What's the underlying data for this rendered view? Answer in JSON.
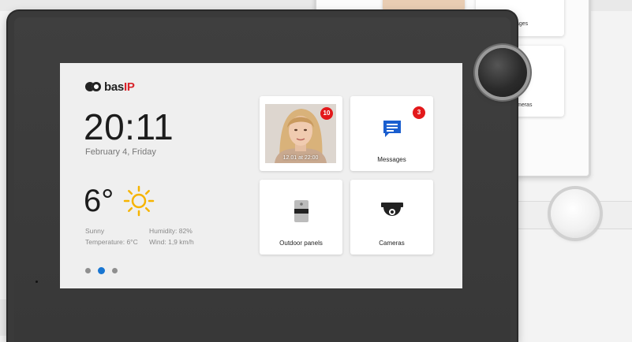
{
  "brand": {
    "logo_text": "bas",
    "logo_accent": "IP",
    "accent_color": "#d8232a"
  },
  "clock": {
    "time": "20:11",
    "date": "February 4, Friday"
  },
  "weather": {
    "temperature": "6°",
    "icon": "sun-icon",
    "condition": "Sunny",
    "temperature_detail": "Temperature: 6°C",
    "humidity": "Humidity: 82%",
    "wind": "Wind: 1,9 km/h"
  },
  "pager": {
    "pages": 3,
    "active_index": 1,
    "active_color": "#1976d2"
  },
  "tiles": {
    "photo": {
      "caption": "12.01 at 22:00",
      "badge": "10"
    },
    "messages": {
      "label": "Messages",
      "badge": "3",
      "icon": "message-icon",
      "icon_color": "#1a5ecf"
    },
    "panels": {
      "label": "Outdoor panels",
      "icon": "outdoor-panel-icon"
    },
    "cameras": {
      "label": "Cameras",
      "icon": "camera-icon"
    }
  },
  "background_ui": {
    "messages_label": "ssages",
    "cameras_label": "meras"
  }
}
